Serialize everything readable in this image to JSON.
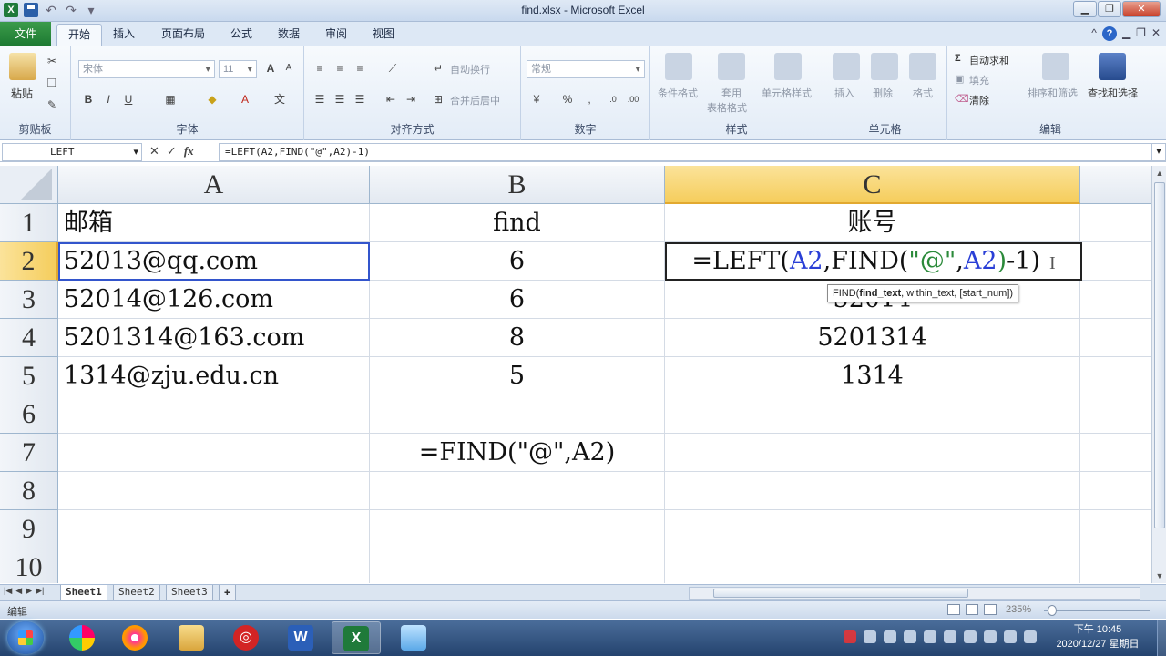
{
  "window": {
    "title": "find.xlsx - Microsoft Excel",
    "controls": {
      "help_up": "^"
    }
  },
  "ribbon": {
    "file_tab": "文件",
    "tabs": [
      "开始",
      "插入",
      "页面布局",
      "公式",
      "数据",
      "审阅",
      "视图"
    ],
    "active_tab": "开始",
    "groups": {
      "clipboard": {
        "label": "剪贴板",
        "paste": "粘贴"
      },
      "font": {
        "label": "字体",
        "font_name": "宋体",
        "font_size": "11"
      },
      "alignment": {
        "label": "对齐方式",
        "wrap": "自动换行",
        "merge": "合并后居中"
      },
      "number": {
        "label": "数字",
        "format": "常规"
      },
      "styles": {
        "label": "样式",
        "conditional": "条件格式",
        "table_format_1": "套用",
        "table_format_2": "表格格式",
        "cell_styles": "单元格样式"
      },
      "cells": {
        "label": "单元格",
        "insert": "插入",
        "delete": "删除",
        "format": "格式"
      },
      "editing": {
        "label": "编辑",
        "autosum": "自动求和",
        "fill": "填充",
        "clear": "清除",
        "sort": "排序和筛选",
        "find": "查找和选择"
      }
    }
  },
  "formula_bar": {
    "name_box": "LEFT",
    "formula": "=LEFT(A2,FIND(\"@\",A2)-1)"
  },
  "grid": {
    "columns": [
      "A",
      "B",
      "C"
    ],
    "selected_column": "C",
    "rows": [
      "1",
      "2",
      "3",
      "4",
      "5",
      "6",
      "7",
      "8",
      "9",
      "10"
    ],
    "selected_row": "2",
    "cells": {
      "A1": "邮箱",
      "B1": "find",
      "C1": "账号",
      "A2": "52013@qq.com",
      "B2": "6",
      "A3": "52014@126.com",
      "B3": "6",
      "C3": "52014",
      "A4": "5201314@163.com",
      "B4": "8",
      "C4": "5201314",
      "A5": "1314@zju.edu.cn",
      "B5": "5",
      "C5": "1314",
      "B7": "=FIND(\"@\",A2)"
    },
    "editing_cell": {
      "parts": {
        "p1": "=LEFT(",
        "p2": "A2",
        "p3": ",FIND(",
        "p4": "\"@\"",
        "p5": ",",
        "p6": "A2",
        "p7": ")",
        "p8": "-1)"
      }
    },
    "tooltip": {
      "prefix": "FIND(",
      "bold_arg": "find_text",
      "rest": ", within_text, [start_num])"
    }
  },
  "sheets": [
    "Sheet1",
    "Sheet2",
    "Sheet3"
  ],
  "active_sheet": "Sheet1",
  "status": {
    "mode": "编辑",
    "zoom": "235%"
  },
  "taskbar": {
    "time": "下午 10:45",
    "date": "2020/12/27 星期日"
  },
  "colors": {
    "excel_green": "#1f7a3a",
    "selected_header": "#f5cd5c",
    "ref_blue": "#2a3fd6",
    "ref_green": "#2b8a3a"
  }
}
